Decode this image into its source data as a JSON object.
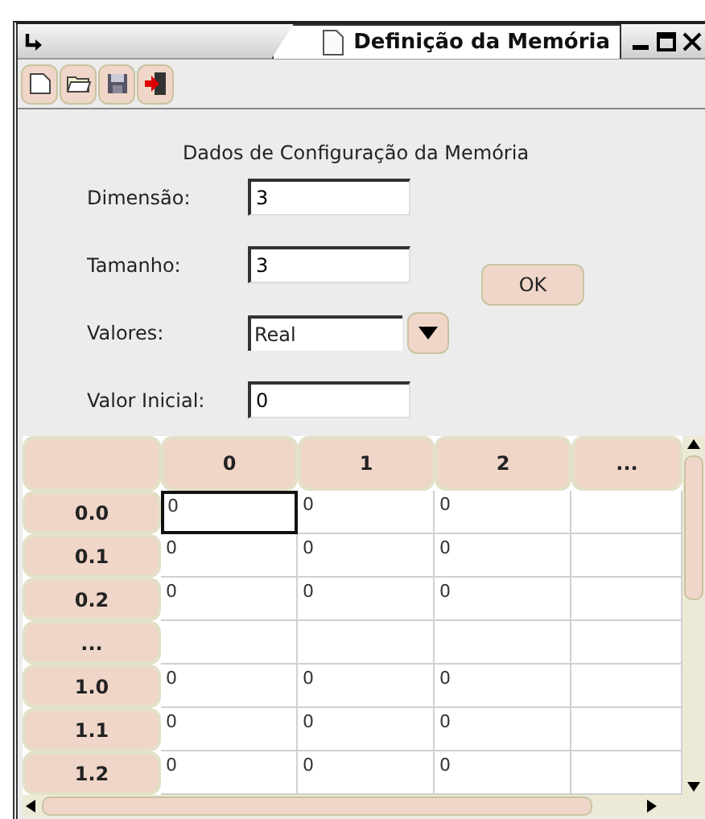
{
  "window": {
    "title": "Definição da Memória"
  },
  "form": {
    "heading": "Dados de Configuração da Memória",
    "fields": [
      {
        "kind": "text",
        "label": "Dimensão:",
        "value": "3"
      },
      {
        "kind": "text",
        "label": "Tamanho:",
        "value": "3"
      },
      {
        "kind": "select",
        "label": "Valores:",
        "value": "Real"
      },
      {
        "kind": "text",
        "label": "Valor Inicial:",
        "value": "0"
      }
    ],
    "ok_button": "OK"
  },
  "table": {
    "columns": [
      "0",
      "1",
      "2",
      "..."
    ],
    "rows": [
      {
        "header": "0.0",
        "cells": [
          {
            "text": "0",
            "selected": true
          },
          {
            "text": "0",
            "selected": false
          },
          {
            "text": "0",
            "selected": false
          }
        ]
      },
      {
        "header": "0.1",
        "cells": [
          {
            "text": "0",
            "selected": false
          },
          {
            "text": "0",
            "selected": false
          },
          {
            "text": "0",
            "selected": false
          }
        ]
      },
      {
        "header": "0.2",
        "cells": [
          {
            "text": "0",
            "selected": false
          },
          {
            "text": "0",
            "selected": false
          },
          {
            "text": "0",
            "selected": false
          }
        ]
      },
      {
        "header": "..."
      },
      {
        "header": "1.0",
        "cells": [
          {
            "text": "0",
            "selected": false
          },
          {
            "text": "0",
            "selected": false
          },
          {
            "text": "0",
            "selected": false
          }
        ]
      },
      {
        "header": "1.1",
        "cells": [
          {
            "text": "0",
            "selected": false
          },
          {
            "text": "0",
            "selected": false
          },
          {
            "text": "0",
            "selected": false
          }
        ]
      },
      {
        "header": "1.2",
        "cells": [
          {
            "text": "0",
            "selected": false
          },
          {
            "text": "0",
            "selected": false
          },
          {
            "text": "0",
            "selected": false
          }
        ]
      }
    ]
  }
}
